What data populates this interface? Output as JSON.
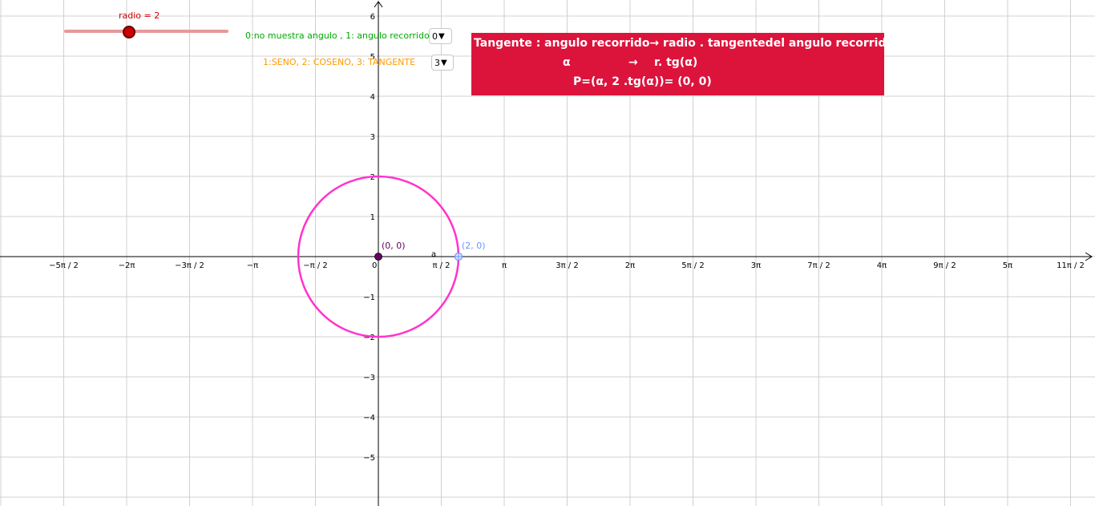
{
  "slider": {
    "label": "radio = 2",
    "value": 2
  },
  "angle_control": {
    "label": "0:no muestra angulo , 1: angulo recorrido",
    "value": "0",
    "color": "#00aa00"
  },
  "function_control": {
    "label": "1:SENO, 2: COSENO, 3: TANGENTE",
    "value": "3",
    "color": "#ff9900"
  },
  "info_box": {
    "line1": "Tangente : angulo recorrido→  radio . tangentedel angulo recorrido",
    "line2_left": "α",
    "line2_arrow": "→",
    "line2_right": "r. tg(α)",
    "line3": "P=(α, 2 .tg(α))=  (0, 0)",
    "background": "#dc143c"
  },
  "graph": {
    "x_ticks": [
      "−5π / 2",
      "−2π",
      "−3π / 2",
      "−π",
      "−π / 2",
      "0",
      "π / 2",
      "π",
      "3π / 2",
      "2π",
      "5π / 2",
      "3π",
      "7π / 2",
      "4π",
      "9π / 2",
      "5π",
      "11π / 2"
    ],
    "y_ticks": [
      "−5",
      "−4",
      "−3",
      "−2",
      "−1",
      "1",
      "2",
      "3",
      "4",
      "5",
      "6"
    ],
    "circle_radius": 2,
    "circle_color": "#ff33cc",
    "origin_point": {
      "label": "(0, 0)",
      "color": "#660066"
    },
    "moving_point": {
      "label": "(2, 0)",
      "color": "#6699ff"
    },
    "angle_label": "a"
  }
}
